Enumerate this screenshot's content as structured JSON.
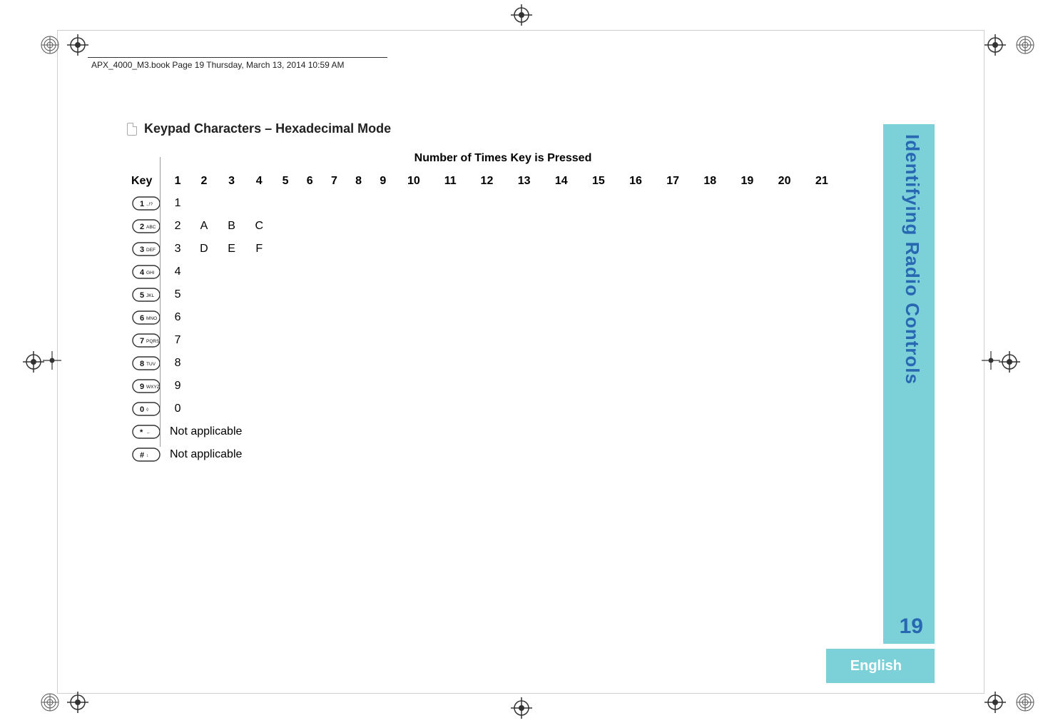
{
  "header": {
    "running_text": "APX_4000_M3.book  Page 19  Thursday, March 13, 2014  10:59 AM"
  },
  "section": {
    "title": "Keypad Characters – Hexadecimal Mode"
  },
  "table": {
    "caption": "Number of Times Key is Pressed",
    "key_header": "Key",
    "columns": [
      "1",
      "2",
      "3",
      "4",
      "5",
      "6",
      "7",
      "8",
      "9",
      "10",
      "11",
      "12",
      "13",
      "14",
      "15",
      "16",
      "17",
      "18",
      "19",
      "20",
      "21"
    ],
    "rows": [
      {
        "key_label": "1 .,!?",
        "cells": [
          "1",
          "",
          "",
          "",
          "",
          "",
          "",
          "",
          "",
          "",
          "",
          "",
          "",
          "",
          "",
          "",
          "",
          "",
          "",
          "",
          ""
        ]
      },
      {
        "key_label": "2 ABC",
        "cells": [
          "2",
          "A",
          "B",
          "C",
          "",
          "",
          "",
          "",
          "",
          "",
          "",
          "",
          "",
          "",
          "",
          "",
          "",
          "",
          "",
          "",
          ""
        ]
      },
      {
        "key_label": "3 DEF",
        "cells": [
          "3",
          "D",
          "E",
          "F",
          "",
          "",
          "",
          "",
          "",
          "",
          "",
          "",
          "",
          "",
          "",
          "",
          "",
          "",
          "",
          "",
          ""
        ]
      },
      {
        "key_label": "4 GHI",
        "cells": [
          "4",
          "",
          "",
          "",
          "",
          "",
          "",
          "",
          "",
          "",
          "",
          "",
          "",
          "",
          "",
          "",
          "",
          "",
          "",
          "",
          ""
        ]
      },
      {
        "key_label": "5 JKL",
        "cells": [
          "5",
          "",
          "",
          "",
          "",
          "",
          "",
          "",
          "",
          "",
          "",
          "",
          "",
          "",
          "",
          "",
          "",
          "",
          "",
          "",
          ""
        ]
      },
      {
        "key_label": "6 MNO",
        "cells": [
          "6",
          "",
          "",
          "",
          "",
          "",
          "",
          "",
          "",
          "",
          "",
          "",
          "",
          "",
          "",
          "",
          "",
          "",
          "",
          "",
          ""
        ]
      },
      {
        "key_label": "7 PQRS",
        "cells": [
          "7",
          "",
          "",
          "",
          "",
          "",
          "",
          "",
          "",
          "",
          "",
          "",
          "",
          "",
          "",
          "",
          "",
          "",
          "",
          "",
          ""
        ]
      },
      {
        "key_label": "8 TUV",
        "cells": [
          "8",
          "",
          "",
          "",
          "",
          "",
          "",
          "",
          "",
          "",
          "",
          "",
          "",
          "",
          "",
          "",
          "",
          "",
          "",
          "",
          ""
        ]
      },
      {
        "key_label": "9 WXYZ",
        "cells": [
          "9",
          "",
          "",
          "",
          "",
          "",
          "",
          "",
          "",
          "",
          "",
          "",
          "",
          "",
          "",
          "",
          "",
          "",
          "",
          "",
          ""
        ]
      },
      {
        "key_label": "0 ◊",
        "cells": [
          "0",
          "",
          "",
          "",
          "",
          "",
          "",
          "",
          "",
          "",
          "",
          "",
          "",
          "",
          "",
          "",
          "",
          "",
          "",
          "",
          ""
        ]
      },
      {
        "key_label": "* ←",
        "span_text": "Not applicable"
      },
      {
        "key_label": "# ↕",
        "span_text": "Not applicable"
      }
    ]
  },
  "side": {
    "tab_label": "Identifying Radio Controls",
    "page_number": "19",
    "language": "English"
  },
  "icons": {
    "crop": "crop-mark-icon",
    "reg": "registration-mark-icon",
    "target": "target-icon"
  }
}
